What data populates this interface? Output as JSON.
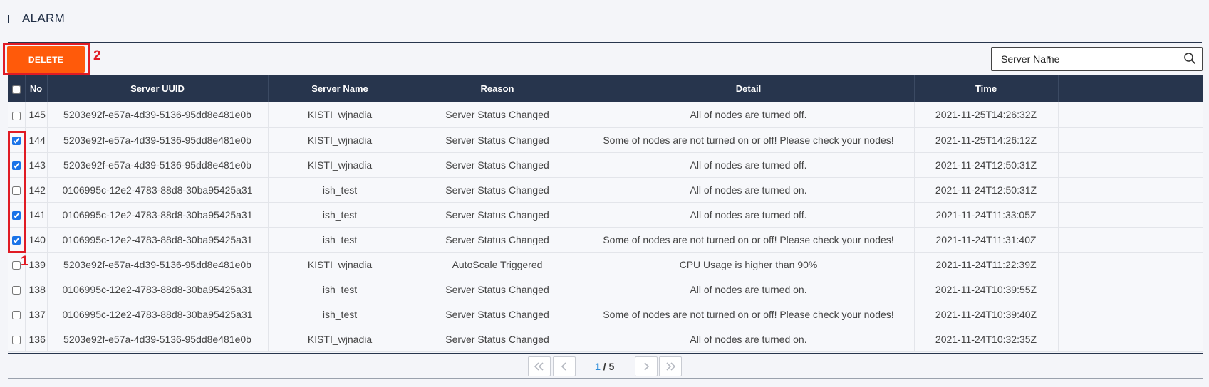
{
  "page": {
    "title": "ALARM"
  },
  "toolbar": {
    "delete_label": "DELETE",
    "search_placeholder": "Server Name",
    "search_value": "Server Name",
    "accent_color": "#ff5a0a"
  },
  "annotations": {
    "label_1": "1",
    "label_2": "2",
    "color": "#e01b24"
  },
  "table": {
    "columns": [
      "",
      "No",
      "Server UUID",
      "Server Name",
      "Reason",
      "Detail",
      "Time",
      ""
    ],
    "rows": [
      {
        "checked": false,
        "no": "145",
        "uuid": "5203e92f-e57a-4d39-5136-95dd8e481e0b",
        "name": "KISTI_wjnadia",
        "reason": "Server Status Changed",
        "detail": "All of nodes are turned off.",
        "time": "2021-11-25T14:26:32Z"
      },
      {
        "checked": true,
        "no": "144",
        "uuid": "5203e92f-e57a-4d39-5136-95dd8e481e0b",
        "name": "KISTI_wjnadia",
        "reason": "Server Status Changed",
        "detail": "Some of nodes are not turned on or off! Please check your nodes!",
        "time": "2021-11-25T14:26:12Z"
      },
      {
        "checked": true,
        "no": "143",
        "uuid": "5203e92f-e57a-4d39-5136-95dd8e481e0b",
        "name": "KISTI_wjnadia",
        "reason": "Server Status Changed",
        "detail": "All of nodes are turned off.",
        "time": "2021-11-24T12:50:31Z"
      },
      {
        "checked": false,
        "no": "142",
        "uuid": "0106995c-12e2-4783-88d8-30ba95425a31",
        "name": "ish_test",
        "reason": "Server Status Changed",
        "detail": "All of nodes are turned on.",
        "time": "2021-11-24T12:50:31Z"
      },
      {
        "checked": true,
        "no": "141",
        "uuid": "0106995c-12e2-4783-88d8-30ba95425a31",
        "name": "ish_test",
        "reason": "Server Status Changed",
        "detail": "All of nodes are turned off.",
        "time": "2021-11-24T11:33:05Z"
      },
      {
        "checked": true,
        "no": "140",
        "uuid": "0106995c-12e2-4783-88d8-30ba95425a31",
        "name": "ish_test",
        "reason": "Server Status Changed",
        "detail": "Some of nodes are not turned on or off! Please check your nodes!",
        "time": "2021-11-24T11:31:40Z"
      },
      {
        "checked": false,
        "no": "139",
        "uuid": "5203e92f-e57a-4d39-5136-95dd8e481e0b",
        "name": "KISTI_wjnadia",
        "reason": "AutoScale Triggered",
        "detail": "CPU Usage is higher than 90%",
        "time": "2021-11-24T11:22:39Z"
      },
      {
        "checked": false,
        "no": "138",
        "uuid": "0106995c-12e2-4783-88d8-30ba95425a31",
        "name": "ish_test",
        "reason": "Server Status Changed",
        "detail": "All of nodes are turned on.",
        "time": "2021-11-24T10:39:55Z"
      },
      {
        "checked": false,
        "no": "137",
        "uuid": "0106995c-12e2-4783-88d8-30ba95425a31",
        "name": "ish_test",
        "reason": "Server Status Changed",
        "detail": "Some of nodes are not turned on or off! Please check your nodes!",
        "time": "2021-11-24T10:39:40Z"
      },
      {
        "checked": false,
        "no": "136",
        "uuid": "5203e92f-e57a-4d39-5136-95dd8e481e0b",
        "name": "KISTI_wjnadia",
        "reason": "Server Status Changed",
        "detail": "All of nodes are turned on.",
        "time": "2021-11-24T10:32:35Z"
      }
    ]
  },
  "pagination": {
    "current": "1",
    "separator": " / ",
    "total": "5"
  }
}
